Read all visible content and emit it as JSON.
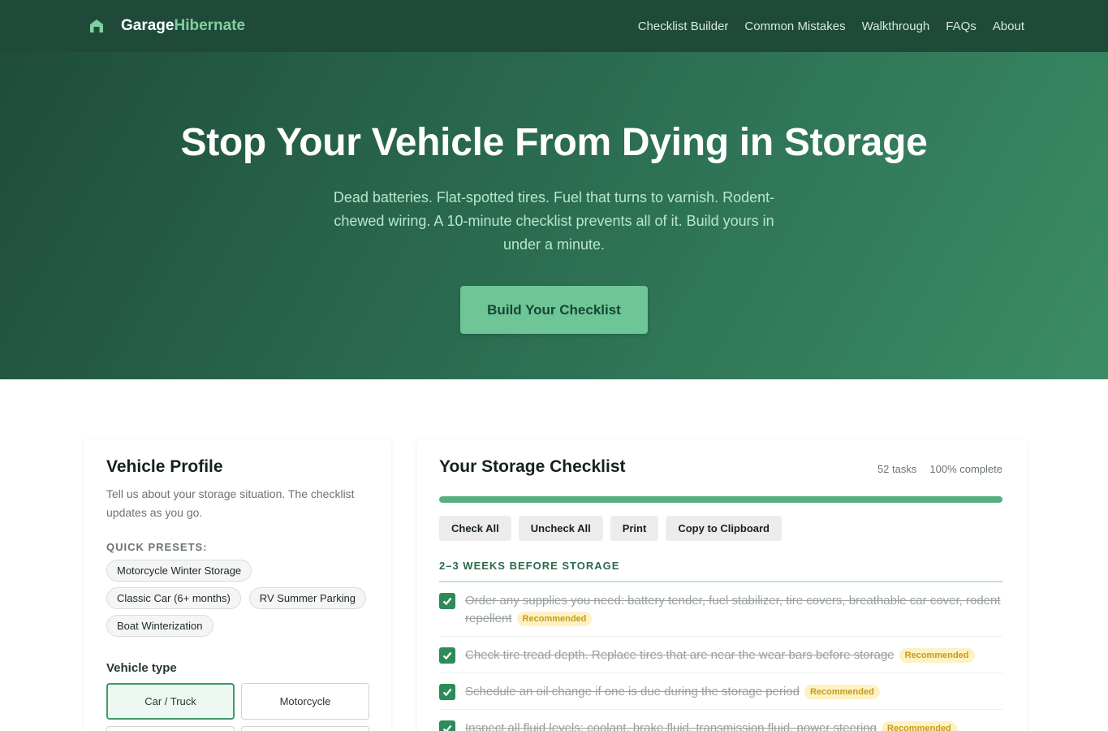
{
  "brand": {
    "name_main": "Garage",
    "name_accent": "Hibernate",
    "icon": "garage-house-icon"
  },
  "nav": [
    "Checklist Builder",
    "Common Mistakes",
    "Walkthrough",
    "FAQs",
    "About"
  ],
  "hero": {
    "title": "Stop Your Vehicle From Dying in Storage",
    "subtitle": "Dead batteries. Flat-spotted tires. Fuel that turns to varnish. Rodent-chewed wiring. A 10-minute checklist prevents all of it. Build yours in under a minute.",
    "cta": "Build Your Checklist"
  },
  "profile": {
    "title": "Vehicle Profile",
    "description": "Tell us about your storage situation. The checklist updates as you go.",
    "presets_label": "QUICK PRESETS:",
    "presets": [
      "Motorcycle Winter Storage",
      "Classic Car (6+ months)",
      "RV Summer Parking",
      "Boat Winterization"
    ],
    "vehicle_type_label": "Vehicle type",
    "vehicle_types": [
      "Car / Truck",
      "Motorcycle",
      "",
      ""
    ],
    "selected_vehicle_type": "Car / Truck"
  },
  "checklist": {
    "title": "Your Storage Checklist",
    "task_count": "52 tasks",
    "complete_text": "100% complete",
    "progress": 1.0,
    "actions": [
      "Check All",
      "Uncheck All",
      "Print",
      "Copy to Clipboard"
    ],
    "section": "2–3 WEEKS BEFORE STORAGE",
    "items": [
      {
        "text": "Order any supplies you need: battery tender, fuel stabilizer, tire covers, breathable car cover, rodent repellent",
        "badge": "Recommended",
        "checked": true
      },
      {
        "text": "Check tire tread depth. Replace tires that are near the wear bars before storage",
        "badge": "Recommended",
        "checked": true
      },
      {
        "text": "Schedule an oil change if one is due during the storage period",
        "badge": "Recommended",
        "checked": true
      },
      {
        "text": "Inspect all fluid levels: coolant, brake fluid, transmission fluid, power steering",
        "badge": "Recommended",
        "checked": true
      }
    ]
  },
  "colors": {
    "header": "#1f4a39",
    "accent": "#7ed0a3",
    "cta": "#6ec595",
    "check": "#2f8a5a",
    "badge_bg": "#fdf2c4",
    "badge_text": "#c89a18"
  }
}
